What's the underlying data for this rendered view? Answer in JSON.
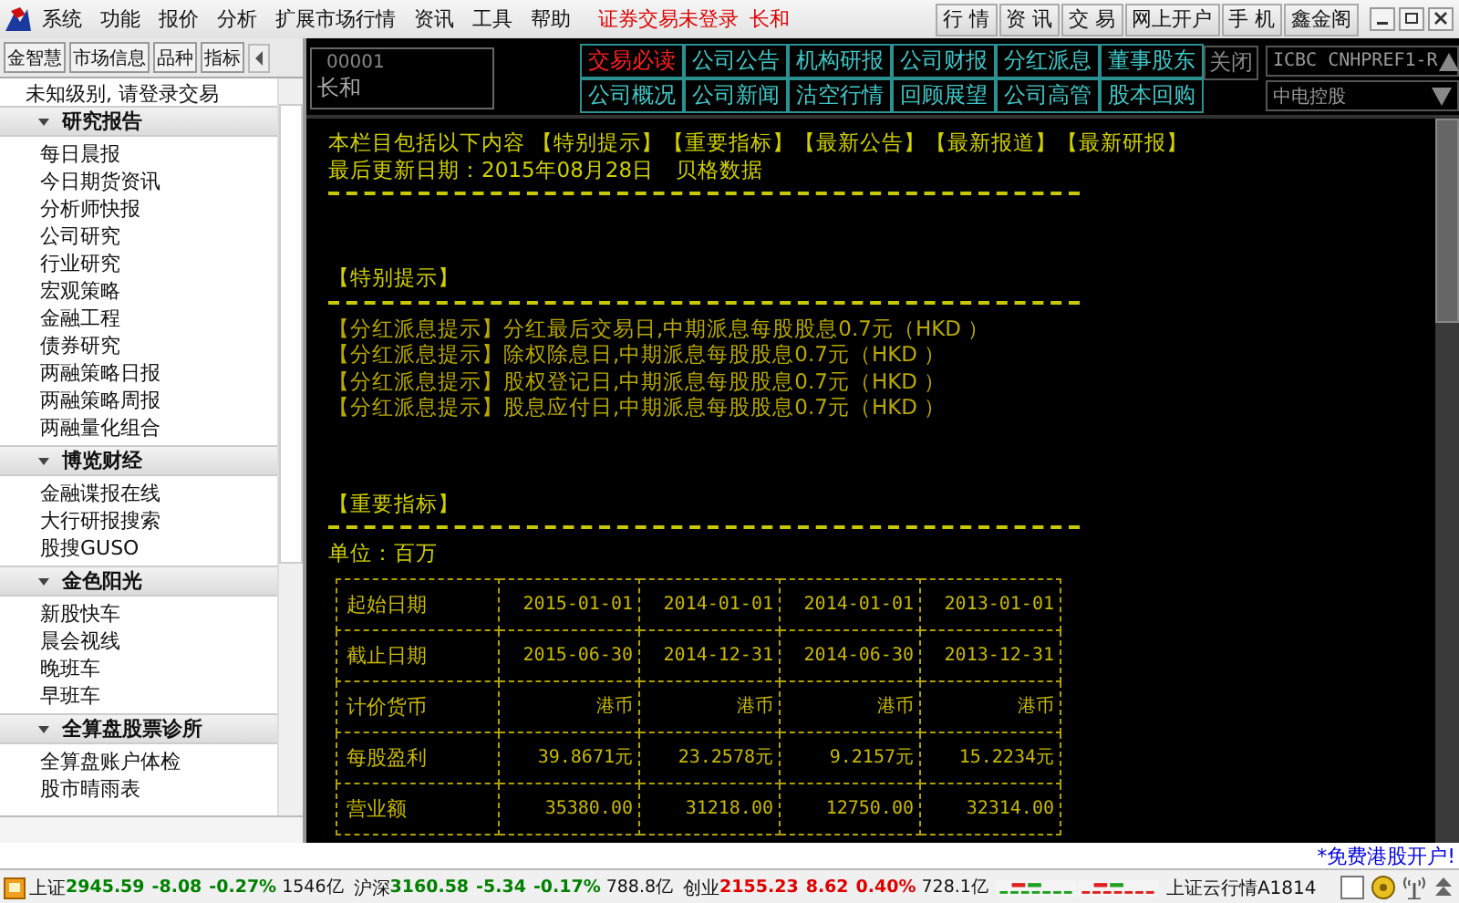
{
  "menu": {
    "items": [
      "系统",
      "功能",
      "报价",
      "分析",
      "扩展市场行情",
      "资讯",
      "工具",
      "帮助"
    ],
    "login_status": "证券交易未登录",
    "stock": "长和",
    "buttons": [
      "行 情",
      "资 讯",
      "交 易",
      "网上开户",
      "手 机",
      "鑫金阁"
    ]
  },
  "sidebar": {
    "tabs": [
      "金智慧",
      "市场信息",
      "品种",
      "指标"
    ],
    "notice": "未知级别, 请登录交易",
    "sections": [
      {
        "title": "研究报告",
        "expanded": true,
        "items": [
          "每日晨报",
          "今日期货资讯",
          "分析师快报",
          "公司研究",
          "行业研究",
          "宏观策略",
          "金融工程",
          "债券研究",
          "两融策略日报",
          "两融策略周报",
          "两融量化组合"
        ]
      },
      {
        "title": "博览财经",
        "expanded": true,
        "items": [
          "金融谍报在线",
          "大行研报搜索",
          "股搜GUSO"
        ]
      },
      {
        "title": "金色阳光",
        "expanded": true,
        "items": [
          "新股快车",
          "晨会视线",
          "晚班车",
          "早班车"
        ]
      },
      {
        "title": "全算盘股票诊所",
        "expanded": true,
        "items": [
          "全算盘账户体检",
          "股市晴雨表"
        ]
      }
    ]
  },
  "quote": {
    "code": "00001",
    "name": "长和"
  },
  "info_buttons": [
    {
      "label": "交易必读",
      "selected": true
    },
    {
      "label": "公司公告",
      "selected": false
    },
    {
      "label": "机构研报",
      "selected": false
    },
    {
      "label": "公司财报",
      "selected": false
    },
    {
      "label": "分红派息",
      "selected": false
    },
    {
      "label": "董事股东",
      "selected": false
    },
    {
      "label": "公司概况",
      "selected": false
    },
    {
      "label": "公司新闻",
      "selected": false
    },
    {
      "label": "沽空行情",
      "selected": false
    },
    {
      "label": "回顾展望",
      "selected": false
    },
    {
      "label": "公司高管",
      "selected": false
    },
    {
      "label": "股本回购",
      "selected": false
    }
  ],
  "close_button": "关闭",
  "dropdowns": [
    "ICBC CNHPREF1-R",
    "中电控股"
  ],
  "content": {
    "intro": "本栏目包括以下内容 【特别提示】【重要指标】【最新公告】【最新报道】【最新研报】",
    "updated": "最后更新日期：2015年08月28日　贝格数据",
    "tips_title": "【特别提示】",
    "tips": [
      {
        "tag": "【分红派息提示】",
        "text": "分红最后交易日,中期派息每股股息0.7元（HKD ）"
      },
      {
        "tag": "【分红派息提示】",
        "text": "除权除息日,中期派息每股股息0.7元（HKD ）"
      },
      {
        "tag": "【分红派息提示】",
        "text": "股权登记日,中期派息每股股息0.7元（HKD ）"
      },
      {
        "tag": "【分红派息提示】",
        "text": "股息应付日,中期派息每股股息0.7元（HKD ）"
      }
    ],
    "indicators_title": "【重要指标】",
    "unit": "单位：百万",
    "rows": [
      {
        "label": "起始日期",
        "values": [
          "2015-01-01",
          "2014-01-01",
          "2014-01-01",
          "2013-01-01"
        ]
      },
      {
        "label": "截止日期",
        "values": [
          "2015-06-30",
          "2014-12-31",
          "2014-06-30",
          "2013-12-31"
        ]
      },
      {
        "label": "计价货币",
        "values": [
          "港币",
          "港币",
          "港币",
          "港币"
        ]
      },
      {
        "label": "每股盈利",
        "values": [
          "39.8671元",
          "23.2578元",
          "9.2157元",
          "15.2234元"
        ]
      },
      {
        "label": "营业额",
        "values": [
          "35380.00",
          "31218.00",
          "12750.00",
          "32314.00"
        ]
      }
    ]
  },
  "ticker": "*免费港股开户!",
  "indices": [
    {
      "name": "上证",
      "value": "2945.59",
      "change": "-8.08",
      "pct": "-0.27%",
      "volume": "1546亿",
      "color": "#008000"
    },
    {
      "name": "沪深",
      "value": "3160.58",
      "change": "-5.34",
      "pct": "-0.17%",
      "volume": "788.8亿",
      "color": "#008000"
    },
    {
      "name": "创业",
      "value": "2155.23",
      "change": "8.62",
      "pct": "0.40%",
      "volume": "728.1亿",
      "color": "#e00000"
    }
  ],
  "server": "上证云行情A1814"
}
